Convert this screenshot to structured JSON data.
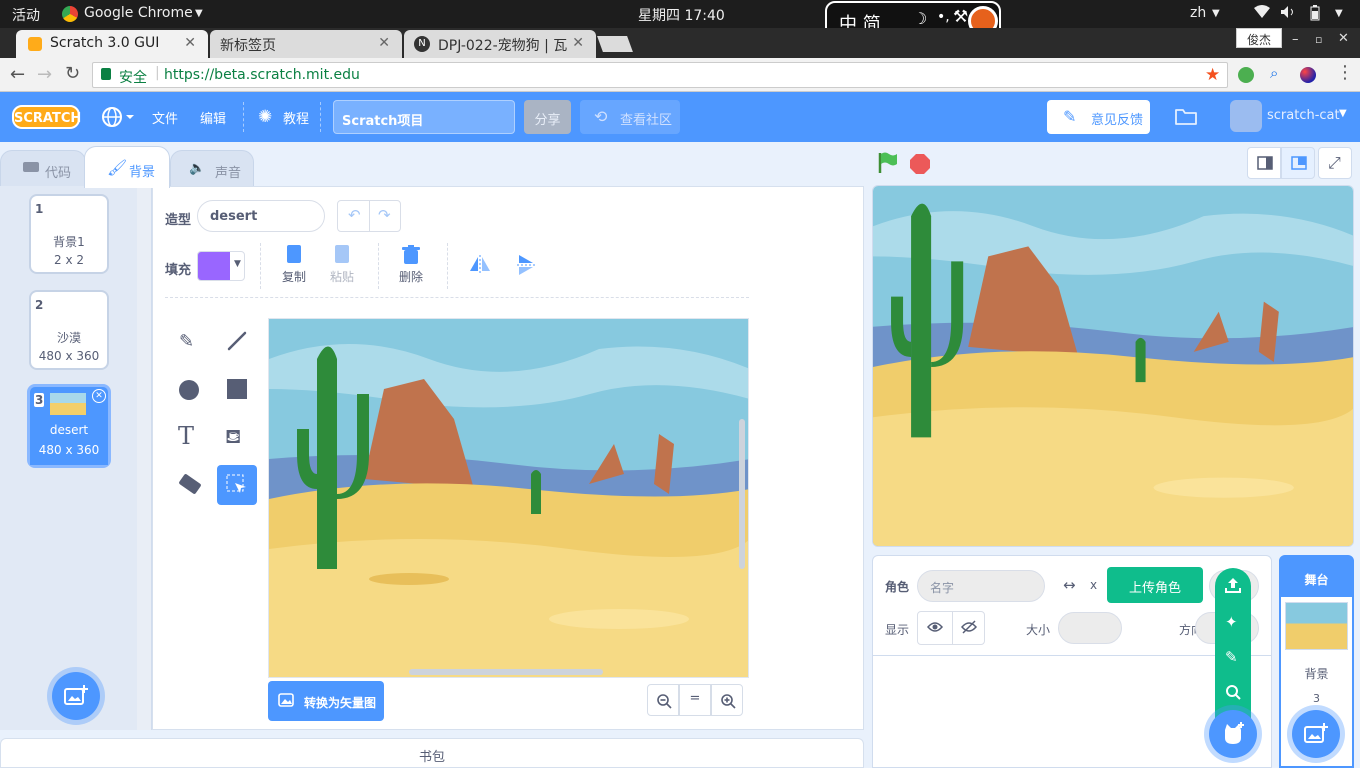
{
  "os": {
    "activities": "活动",
    "app_menu": "Google Chrome",
    "clock": "星期四 17:40",
    "input_method": "中 简",
    "lang": "zh"
  },
  "browser": {
    "tabs": [
      {
        "title": "Scratch 3.0 GUI",
        "active": true
      },
      {
        "title": "新标签页",
        "active": false
      },
      {
        "title": "DPJ-022-宠物狗 | 瓦",
        "active": false
      }
    ],
    "profile": "俊杰",
    "secure_label": "安全",
    "url": "https://beta.scratch.mit.edu"
  },
  "menubar": {
    "logo": "SCRATCH",
    "file": "文件",
    "edit": "编辑",
    "tutorials": "教程",
    "project_title": "Scratch项目",
    "share": "分享",
    "see_community": "查看社区",
    "feedback": "意见反馈",
    "username": "scratch-cat"
  },
  "editor_tabs": {
    "code": "代码",
    "costumes": "背景",
    "sounds": "声音"
  },
  "backdrops": [
    {
      "index": "1",
      "name": "背景1",
      "size": "2 x 2",
      "selected": false
    },
    {
      "index": "2",
      "name": "沙漠",
      "size": "480 x 360",
      "selected": false
    },
    {
      "index": "3",
      "name": "desert",
      "size": "480 x 360",
      "selected": true
    }
  ],
  "paint": {
    "costume_label": "造型",
    "costume_name": "desert",
    "fill_label": "填充",
    "fill_color": "#9966ff",
    "copy": "复制",
    "paste": "粘贴",
    "delete": "删除",
    "convert": "转换为矢量图",
    "zoom_reset": "="
  },
  "backpack": "书包",
  "sprite_info": {
    "sprite_label": "角色",
    "name_placeholder": "名字",
    "x_label": "x",
    "show_label": "显示",
    "size_label": "大小",
    "direction_label": "方向",
    "upload_tooltip": "上传角色"
  },
  "stage_pane": {
    "title": "舞台",
    "backdrops_label": "背景",
    "backdrop_count": "3"
  },
  "colors": {
    "scratch_blue": "#4d97ff",
    "sprite_green": "#0fbd8c",
    "fill_purple": "#9966ff"
  }
}
